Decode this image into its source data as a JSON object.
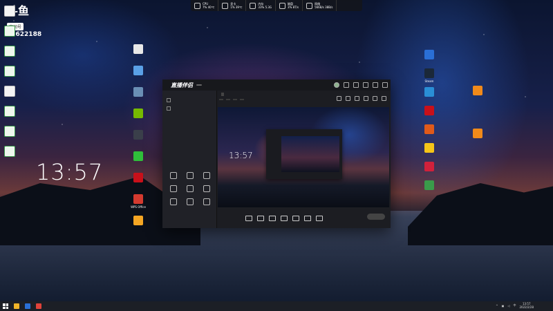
{
  "brand_logo": {
    "name": "斗鱼",
    "room_label": "房间号",
    "room_number": "10622188"
  },
  "clock": {
    "time": "13:57"
  },
  "stats": [
    {
      "icon": "cpu-icon",
      "label": "CPU",
      "value": "7%  40℃"
    },
    {
      "icon": "gpu-icon",
      "label": "显卡",
      "value": "1%  39℃"
    },
    {
      "icon": "memory-icon",
      "label": "内存",
      "value": "33%  5.3G"
    },
    {
      "icon": "disk-icon",
      "label": "磁盘",
      "value": "3%  8T/s"
    },
    {
      "icon": "network-icon",
      "label": "网络",
      "value": "566B/s  38B/s"
    }
  ],
  "left_desktop_icons": [
    {
      "label": "",
      "type": "file"
    },
    {
      "label": "",
      "type": "xls"
    },
    {
      "label": "",
      "type": "xls"
    },
    {
      "label": "",
      "type": "xls"
    },
    {
      "label": "",
      "type": "file"
    },
    {
      "label": "",
      "type": "xls"
    },
    {
      "label": "",
      "type": "xls"
    },
    {
      "label": "",
      "type": "xls"
    }
  ],
  "mid_desktop_icons": [
    {
      "label": "",
      "color": "#e8e8e8"
    },
    {
      "label": "",
      "color": "#5aa0e6"
    },
    {
      "label": "",
      "color": "#6a8fb5"
    },
    {
      "label": "",
      "color": "#76b900"
    },
    {
      "label": "",
      "color": "#3a3f4a"
    },
    {
      "label": "",
      "color": "#2fbf3a"
    },
    {
      "label": "",
      "color": "#c8101a"
    },
    {
      "label": "WPS Office",
      "color": "#d43a2f"
    },
    {
      "label": "",
      "color": "#f5a623"
    }
  ],
  "right_desktop_icons_col1": [
    {
      "label": "",
      "color": "#2a6fd6"
    },
    {
      "label": "Steam",
      "color": "#1b2838"
    },
    {
      "label": "",
      "color": "#2a8fd6"
    },
    {
      "label": "",
      "color": "#c8101a"
    },
    {
      "label": "",
      "color": "#e05a1a"
    },
    {
      "label": "",
      "color": "#f5c518"
    },
    {
      "label": "",
      "color": "#d0213b"
    },
    {
      "label": "",
      "color": "#3a9b4a"
    }
  ],
  "right_desktop_icons_col2": [
    {
      "label": "",
      "color": "#f08a1a"
    },
    {
      "label": "",
      "color": "#f08a1a"
    }
  ],
  "app": {
    "brand": "直播伴侣",
    "version": "",
    "side_tabs": [
      "",
      "",
      ""
    ],
    "scenes": [
      "",
      ""
    ],
    "tools_title": "",
    "tools": [
      "",
      "",
      "",
      "",
      "",
      "",
      "",
      "",
      ""
    ],
    "notice": "",
    "room_title": "",
    "room_tag": "",
    "room_info": [
      "",
      "",
      "",
      ""
    ],
    "preview_clock": "13:57",
    "bottom_buttons": [
      "",
      "",
      "",
      "",
      "",
      "",
      ""
    ],
    "go_live": ""
  },
  "taskbar": {
    "tray_time": "13:57",
    "tray_date": "2022/2/28",
    "tray_lang": "中"
  }
}
